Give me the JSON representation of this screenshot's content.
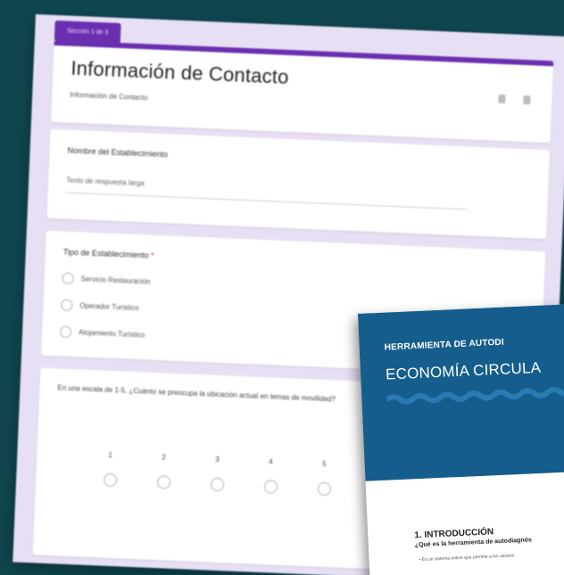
{
  "form": {
    "section_badge": "Sección 1 de 3",
    "title": "Información de Contacto",
    "subtitle": "Información de Contacto",
    "question1": {
      "label": "Nombre del Establecimiento",
      "answer_placeholder": "Texto de respuesta larga"
    },
    "question2": {
      "label": "Tipo de Establecimiento",
      "required_mark": "*",
      "options": [
        "Servicio Restauración",
        "Operador Turístico",
        "Alojamiento Turístico"
      ]
    },
    "question3": {
      "label": "En una escala de 1-5, ¿Cuánto se preocupa la ubicación actual en temas de movilidad?",
      "scale": [
        "1",
        "2",
        "3",
        "4",
        "5"
      ]
    }
  },
  "document": {
    "kicker": "HERRAMIENTA DE AUTODI",
    "heading": "ECONOMÍA CIRCULA",
    "section_title": "1. INTRODUCCIÓN",
    "question": "¿Qué es la herramienta de autodiagnós",
    "bullet": "• Es un sistema online que permite a los usuario"
  }
}
